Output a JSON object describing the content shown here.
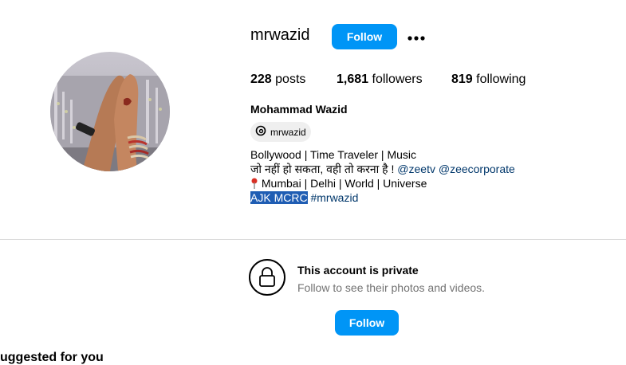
{
  "profile": {
    "username": "mrwazid",
    "follow_label": "Follow",
    "more_icon": "more-horizontal-icon",
    "stats": {
      "posts_count": "228",
      "posts_label": "posts",
      "followers_count": "1,681",
      "followers_label": "followers",
      "following_count": "819",
      "following_label": "following"
    },
    "full_name": "Mohammad Wazid",
    "threads_handle": "mrwazid",
    "bio": {
      "line1": "Bollywood | Time Traveler | Music",
      "line2_text": "जो नहीं हो सकता, वही तो करना है !",
      "mention1": "@zeetv",
      "mention2": "@zeecorporate",
      "line3": "Mumbai | Delhi | World | Universe",
      "line4_selected": "AJK MCRC",
      "hashtag": "#mrwazid"
    }
  },
  "private_notice": {
    "title": "This account is private",
    "subtitle": "Follow to see their photos and videos.",
    "follow_label": "Follow"
  },
  "suggested": {
    "heading": "uggested for you"
  },
  "colors": {
    "accent": "#0095f6",
    "mention": "#00376b",
    "selection": "#1f5db3"
  }
}
